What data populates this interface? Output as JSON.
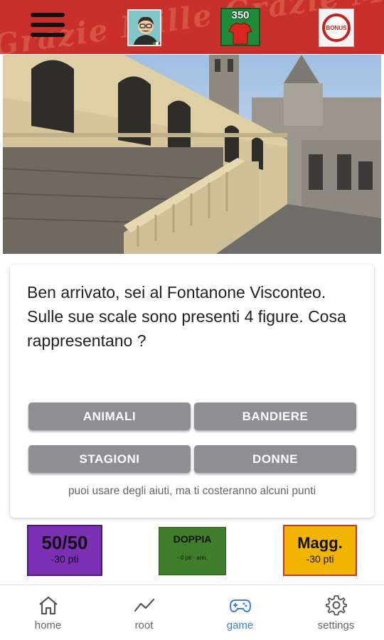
{
  "header": {
    "background_text": "Grazie Mille Grazie Mille",
    "score_value": "350",
    "bonus_label": "BONUS"
  },
  "question": {
    "text": "Ben arrivato, sei al Fontanone Visconteo. Sulle sue scale sono presenti 4 figure. Cosa rappresentano ?"
  },
  "answers": [
    "ANIMALI",
    "BANDIERE",
    "STAGIONI",
    "DONNE"
  ],
  "hint": "puoi usare degli aiuti, ma ti costeranno alcuni punti",
  "helpers": {
    "fifty": {
      "title": "50/50",
      "cost": "-30 pti",
      "color": "#7b2fb5"
    },
    "doppia": {
      "title": "DOPPIA",
      "cost": "- 0 pti - ann.",
      "color": "#3f7d2a"
    },
    "magg": {
      "title": "Magg.",
      "cost": "-30 pti",
      "color": "#f3b400"
    }
  },
  "nav": [
    {
      "label": "home",
      "icon": "home-icon"
    },
    {
      "label": "root",
      "icon": "trend-icon"
    },
    {
      "label": "game",
      "icon": "gamepad-icon",
      "active": true
    },
    {
      "label": "settings",
      "icon": "gear-icon"
    }
  ],
  "colors": {
    "header_red": "#c9302c",
    "answer_gray": "#8e8e93",
    "nav_active": "#3d7fe0"
  }
}
